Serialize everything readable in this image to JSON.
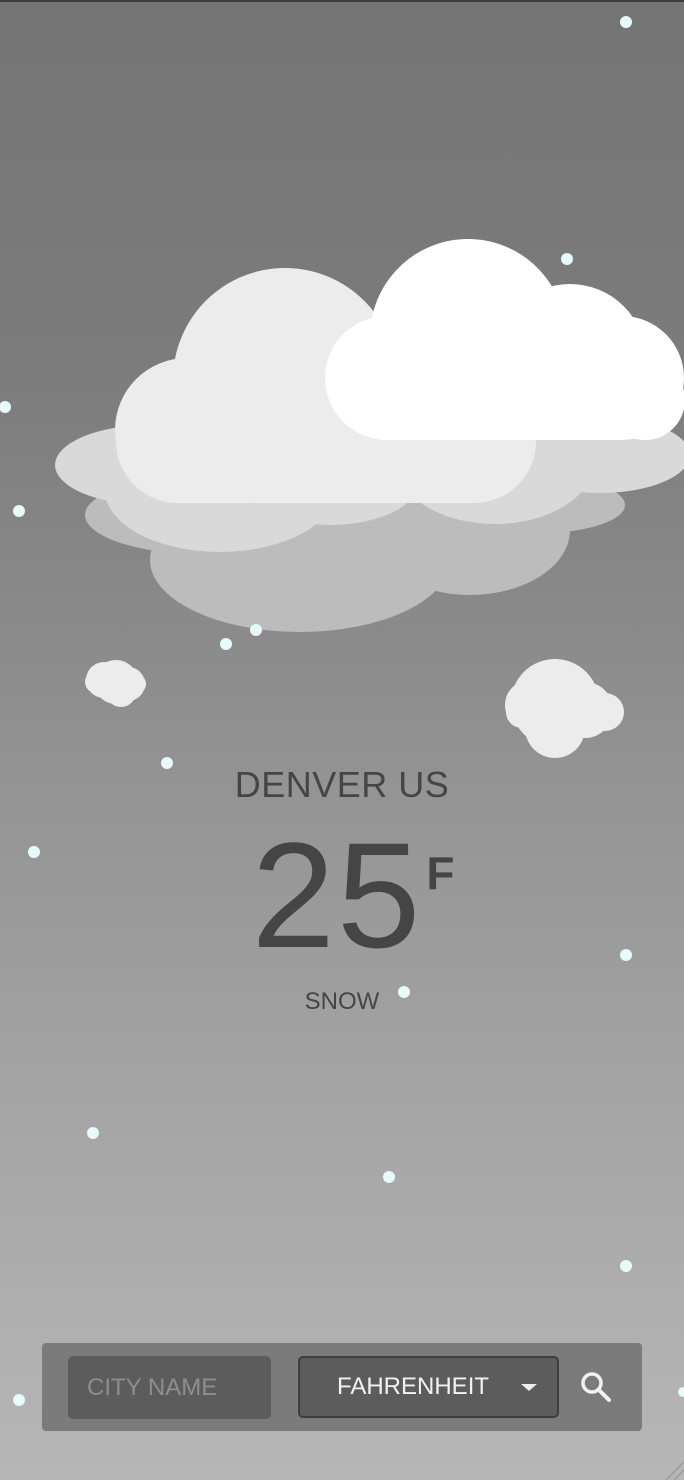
{
  "weather": {
    "location": "DENVER US",
    "temperature": "25",
    "unit_symbol": "F",
    "condition": "SNOW"
  },
  "search": {
    "city_placeholder": "CITY NAME",
    "unit_selected": "FAHRENHEIT",
    "search_icon": "search-icon",
    "dropdown_icon": "chevron-down-icon"
  },
  "colors": {
    "text": "#454545",
    "snow": "#e6fbfb",
    "panel": "#7b7b7b",
    "field": "#5c5c5c"
  }
}
